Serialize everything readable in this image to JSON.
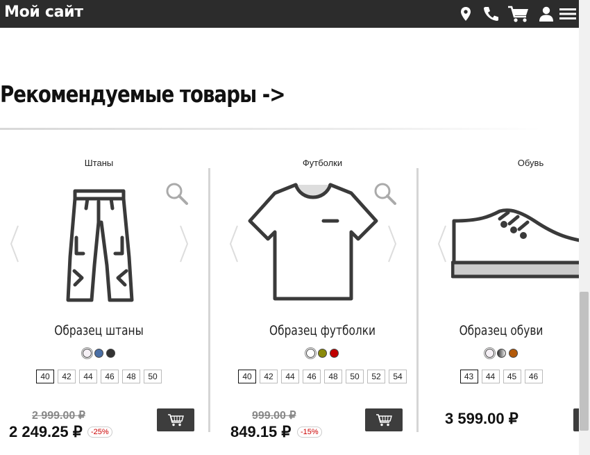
{
  "site": {
    "title": "Мой сайт"
  },
  "header_icons": [
    "location-pin-icon",
    "phone-icon",
    "cart-icon",
    "user-icon",
    "menu-icon"
  ],
  "section": {
    "title": "Рекомендуемые товары ->"
  },
  "colors": {
    "header_bg": "#2c2c2c",
    "button_bg": "#3d3d3d",
    "discount": "#cc0000"
  },
  "products": [
    {
      "category": "Штаны",
      "name": "Образец штаны",
      "image": "pants-icon",
      "swatches": [
        "#f5f0f5",
        "#4a6fa5",
        "#333333"
      ],
      "sizes": [
        "40",
        "42",
        "44",
        "46",
        "48",
        "50"
      ],
      "selected_size": "40",
      "old_price": "2 999.00 ₽",
      "price": "2 249.25 ₽",
      "discount": "-25%"
    },
    {
      "category": "Футболки",
      "name": "Образец футболки",
      "image": "tshirt-icon",
      "swatches": [
        "#ffffff",
        "#8a8a0a",
        "#c00000"
      ],
      "sizes": [
        "40",
        "42",
        "44",
        "46",
        "48",
        "50",
        "52",
        "54"
      ],
      "selected_size": "40",
      "old_price": "999.00 ₽",
      "price": "849.15 ₽",
      "discount": "-15%"
    },
    {
      "category": "Обувь",
      "name": "Образец обуви",
      "image": "shoe-icon",
      "swatches": [
        "#f5f0f5",
        "#555555",
        "#b35a0a"
      ],
      "sizes": [
        "43",
        "44",
        "45",
        "46"
      ],
      "selected_size": "43",
      "price": "3 599.00 ₽"
    }
  ]
}
